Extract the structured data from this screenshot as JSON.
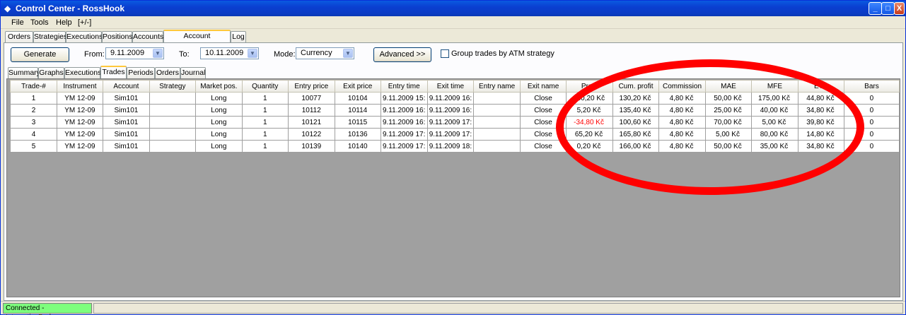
{
  "window": {
    "title": "Control Center - RossHook",
    "controls": {
      "minimize": "_",
      "maximize": "□",
      "close": "X"
    }
  },
  "menu": [
    "File",
    "Tools",
    "Help",
    "[+/-]"
  ],
  "main_tabs": [
    "Orders",
    "Strategies",
    "Executions",
    "Positions",
    "Accounts",
    "Account Performance",
    "Log"
  ],
  "toolbar": {
    "generate_label": "Generate",
    "from_label": "From:",
    "from_value": "9.11.2009",
    "to_label": "To:",
    "to_value": "10.11.2009",
    "mode_label": "Mode:",
    "mode_value": "Currency",
    "advanced_label": "Advanced >>",
    "group_label": "Group trades by ATM strategy"
  },
  "sub_tabs": [
    "Summary",
    "Graphs",
    "Executions",
    "Trades",
    "Periods",
    "Orders",
    "Journal"
  ],
  "table": {
    "headers": [
      "Trade-#",
      "Instrument",
      "Account",
      "Strategy",
      "Market pos.",
      "Quantity",
      "Entry price",
      "Exit price",
      "Entry time",
      "Exit time",
      "Entry name",
      "Exit name",
      "Profit",
      "Cum. profit",
      "Commission",
      "MAE",
      "MFE",
      "ETD",
      "Bars"
    ],
    "rows": [
      [
        "1",
        "YM 12-09",
        "Sim101",
        "",
        "Long",
        "1",
        "10077",
        "10104",
        "9.11.2009 15:",
        "9.11.2009 16:",
        "",
        "Close",
        "130,20 Kč",
        "130,20 Kč",
        "4,80 Kč",
        "50,00 Kč",
        "175,00 Kč",
        "44,80 Kč",
        "0"
      ],
      [
        "2",
        "YM 12-09",
        "Sim101",
        "",
        "Long",
        "1",
        "10112",
        "10114",
        "9.11.2009 16:",
        "9.11.2009 16:",
        "",
        "Close",
        "5,20 Kč",
        "135,40 Kč",
        "4,80 Kč",
        "25,00 Kč",
        "40,00 Kč",
        "34,80 Kč",
        "0"
      ],
      [
        "3",
        "YM 12-09",
        "Sim101",
        "",
        "Long",
        "1",
        "10121",
        "10115",
        "9.11.2009 16:",
        "9.11.2009 17:",
        "",
        "Close",
        "-34,80 Kč",
        "100,60 Kč",
        "4,80 Kč",
        "70,00 Kč",
        "5,00 Kč",
        "39,80 Kč",
        "0"
      ],
      [
        "4",
        "YM 12-09",
        "Sim101",
        "",
        "Long",
        "1",
        "10122",
        "10136",
        "9.11.2009 17:",
        "9.11.2009 17:",
        "",
        "Close",
        "65,20 Kč",
        "165,80 Kč",
        "4,80 Kč",
        "5,00 Kč",
        "80,00 Kč",
        "14,80 Kč",
        "0"
      ],
      [
        "5",
        "YM 12-09",
        "Sim101",
        "",
        "Long",
        "1",
        "10139",
        "10140",
        "9.11.2009 17:",
        "9.11.2009 18:",
        "",
        "Close",
        "0,20 Kč",
        "166,00 Kč",
        "4,80 Kč",
        "50,00 Kč",
        "35,00 Kč",
        "34,80 Kč",
        "0"
      ]
    ]
  },
  "status": {
    "connection": "Connected - InteractiveBrokers"
  },
  "colors": {
    "negative": "#ff0000",
    "status_ok": "#7dff7d",
    "annotation": "#ff0000"
  }
}
